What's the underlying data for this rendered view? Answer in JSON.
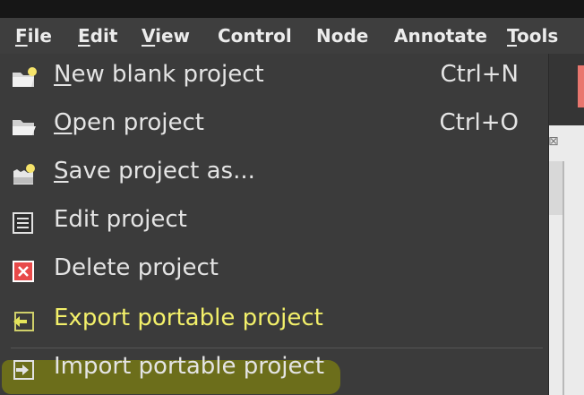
{
  "menubar": {
    "items": [
      {
        "label": "File",
        "mnemonic": "F",
        "rest": "ile"
      },
      {
        "label": "Edit",
        "mnemonic": "E",
        "rest": "dit"
      },
      {
        "label": "View",
        "mnemonic": "V",
        "rest": "iew"
      },
      {
        "label": "Control",
        "mnemonic": "",
        "rest": "Control"
      },
      {
        "label": "Node",
        "mnemonic": "",
        "rest": "Node"
      },
      {
        "label": "Annotate",
        "mnemonic": "",
        "rest": "Annotate"
      },
      {
        "label": "Tools",
        "mnemonic": "T",
        "rest": "ools"
      }
    ]
  },
  "file_menu": {
    "items": [
      {
        "label": "New blank project",
        "mnemonic": "N",
        "rest": "ew blank project",
        "accel": "Ctrl+N",
        "icon": "folder-new-icon"
      },
      {
        "label": "Open project",
        "mnemonic": "O",
        "rest": "pen project",
        "accel": "Ctrl+O",
        "icon": "folder-open-icon"
      },
      {
        "label": "Save project as...",
        "mnemonic": "S",
        "rest": "ave project as...",
        "accel": "",
        "icon": "save-as-icon"
      },
      {
        "label": "Edit project",
        "mnemonic": "",
        "rest": "Edit project",
        "accel": "",
        "icon": "edit-list-icon"
      },
      {
        "label": "Delete project",
        "mnemonic": "",
        "rest": "Delete project",
        "accel": "",
        "icon": "delete-icon"
      },
      {
        "label": "Export portable project",
        "mnemonic": "",
        "rest": "Export portable project",
        "accel": "",
        "icon": "export-icon"
      },
      {
        "label": "Import portable project",
        "mnemonic": "",
        "rest": "Import portable project",
        "accel": "",
        "icon": "import-icon"
      }
    ],
    "highlighted_item": "Export portable project",
    "highlight_color": "#6f7119",
    "highlight_text_color": "#f3f06a"
  }
}
